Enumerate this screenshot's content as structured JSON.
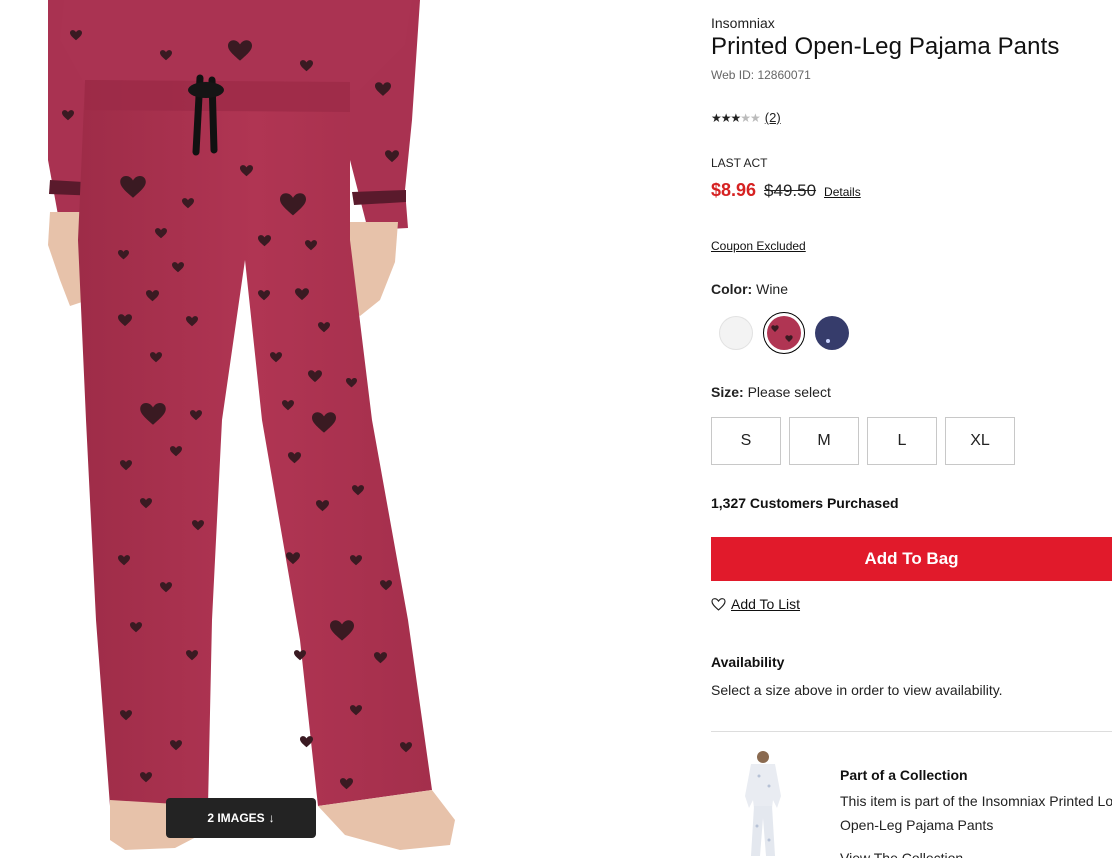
{
  "gallery": {
    "images_label": "2 IMAGES",
    "arrow_glyph": "↓"
  },
  "product": {
    "brand": "Insomniax",
    "title": "Printed Open-Leg Pajama Pants",
    "web_id": "Web ID: 12860071",
    "rating": {
      "stars": 3,
      "max": 5,
      "count_label": "(2)"
    },
    "promo_label": "LAST ACT",
    "price_sale": "$8.96",
    "price_original": "$49.50",
    "details_label": "Details",
    "coupon_label": "Coupon Excluded",
    "color": {
      "label": "Color:",
      "selected": "Wine",
      "swatches": [
        {
          "name": "white",
          "hex": "#f3f3f3"
        },
        {
          "name": "wine",
          "hex": "#b03553"
        },
        {
          "name": "navy",
          "hex": "#363c6b"
        }
      ]
    },
    "size": {
      "label": "Size:",
      "prompt": "Please select",
      "options": [
        "S",
        "M",
        "L",
        "XL"
      ]
    },
    "purchased_label": "1,327 Customers Purchased",
    "add_to_bag_label": "Add To Bag",
    "add_to_list_label": "Add To List",
    "availability": {
      "title": "Availability",
      "text": "Select a size above in order to view availability."
    },
    "collection": {
      "title": "Part of a Collection",
      "text_line1": "This item is part of the Insomniax Printed Long-Sleeve Top &",
      "text_line2": "Open-Leg Pajama Pants",
      "link": "View The Collection"
    }
  },
  "colors": {
    "accent_red": "#e11a2b",
    "sale_red": "#d62222",
    "fabric_wine": "#b03553",
    "heart": "#3a1a22"
  }
}
